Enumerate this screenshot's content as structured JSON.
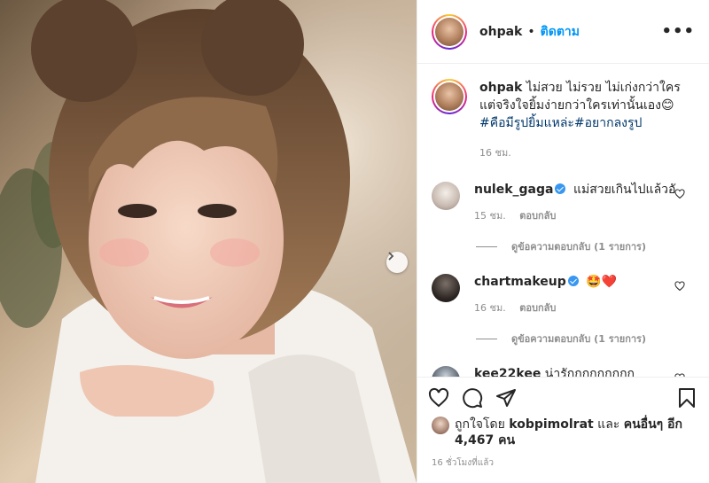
{
  "post": {
    "username": "ohpak",
    "follow_label": "ติดตาม",
    "separator": "•",
    "more_label": "•••"
  },
  "caption": {
    "username": "ohpak",
    "text": "ไม่สวย ไม่รวย ไม่เก่งกว่าใครแต่จริงใจยิ้มง่ายกว่าใครเท่านั้นเอง😊",
    "tags": "#คือมีรูปยิ้มแหล่ะ#อยากลงรูป",
    "time": "16 ชม."
  },
  "comments": [
    {
      "username": "nulek_gaga",
      "verified": true,
      "text": "แม่สวยเกินไปแล้วอั",
      "time": "15 ชม.",
      "reply_label": "ตอบกลับ",
      "view_replies": "ดูข้อความตอบกลับ (1 รายการ)"
    },
    {
      "username": "chartmakeup",
      "verified": true,
      "text": "🤩❤️",
      "time": "16 ชม.",
      "reply_label": "ตอบกลับ",
      "view_replies": "ดูข้อความตอบกลับ (1 รายการ)"
    },
    {
      "username": "kee22kee",
      "verified": false,
      "text": "น่ารักกกกกกกกก"
    }
  ],
  "likes": {
    "prefix": "ถูกใจโดย",
    "user": "kobpimolrat",
    "conj": "และ",
    "others": "คนอื่นๆ อีก 4,467 คน"
  },
  "timestamp": "16 ชั่วโมงที่แล้ว"
}
